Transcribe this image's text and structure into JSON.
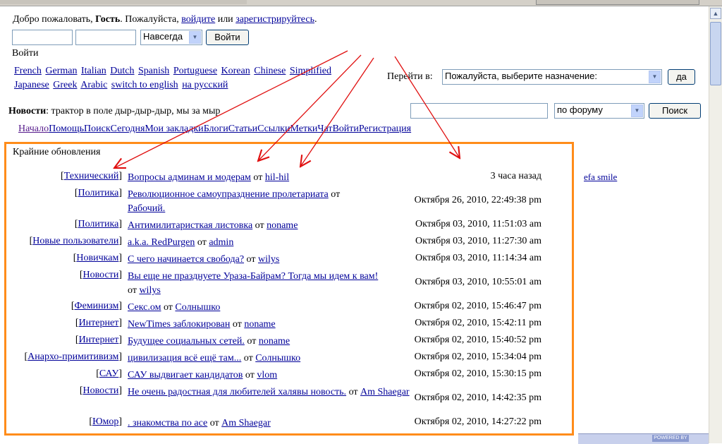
{
  "header": {
    "welcome_prefix": "Добро пожаловать, ",
    "guest": "Гость",
    "welcome_mid": ". Пожалуйста, ",
    "login_link": "войдите",
    "or": " или ",
    "register_link": "зарегистрируйтесь",
    "end": "."
  },
  "login_form": {
    "duration_selected": "Навсегда",
    "login_button": "Войти"
  },
  "login_label": "Войти",
  "languages": [
    "French",
    "German",
    "Italian",
    "Dutch",
    "Spanish",
    "Portuguese",
    "Korean",
    "Chinese",
    "Simplified",
    "Japanese",
    "Greek",
    "Arabic",
    "switch to english",
    "на русский"
  ],
  "jump": {
    "label": "Перейти в:",
    "selected": "Пожалуйста, выберите назначение:",
    "go_button": "да"
  },
  "news": {
    "label": "Новости",
    "text": ": трактор в поле дыр-дыр-дыр, мы за мыр"
  },
  "search": {
    "scope_selected": "по форуму",
    "search_button": "Поиск"
  },
  "nav": [
    "Начало",
    "Помощь",
    "Поиск",
    "Сегодня",
    "Мои закладки",
    "Блоги",
    "Статьи",
    "Ссылки",
    "Метки",
    "Чат",
    "Войти",
    "Регистрация"
  ],
  "recent": {
    "title": "Крайние обновления",
    "by": "от",
    "rows": [
      {
        "category": "Технический",
        "topic": "Вопросы админам и модерам",
        "author": "hil-hil",
        "time": "3 часа назад"
      },
      {
        "category": "Политика",
        "topic": "Революционное самоупразднение пролетариата",
        "author": "Рабочий.",
        "time": "Октября 26, 2010, 22:49:38 pm"
      },
      {
        "category": "Политика",
        "topic": "Антимилитаристкая листовка",
        "author": "noname",
        "time": "Октября 03, 2010, 11:51:03 am"
      },
      {
        "category": "Новые пользователи",
        "topic": "a.k.a. RedPurgen",
        "author": "admin",
        "time": "Октября 03, 2010, 11:27:30 am"
      },
      {
        "category": "Новичкам",
        "topic": "С чего начинается свобода?",
        "author": "wilys",
        "time": "Октября 03, 2010, 11:14:34 am"
      },
      {
        "category": "Новости",
        "topic": "Вы еще не празднуете Ураза-Байрам? Тогда мы идем к вам!",
        "author": "wilys",
        "time": "Октября 03, 2010, 10:55:01 am"
      },
      {
        "category": "Феминизм",
        "topic": "Секс.ом",
        "author": "Солнышко",
        "time": "Октября 02, 2010, 15:46:47 pm"
      },
      {
        "category": "Интернет",
        "topic": "NewTimes заблокирован",
        "author": "noname",
        "time": "Октября 02, 2010, 15:42:11 pm"
      },
      {
        "category": "Интернет",
        "topic": "Будущее социальных сетей.",
        "author": "noname",
        "time": "Октября 02, 2010, 15:40:52 pm"
      },
      {
        "category": "Анархо-примитивизм",
        "topic": "цивилизация всё ещё там...",
        "author": "Солнышко",
        "time": "Октября 02, 2010, 15:34:04 pm"
      },
      {
        "category": "САУ",
        "topic": "САУ выдвигает кандидатов",
        "author": "vlom",
        "time": "Октября 02, 2010, 15:30:15 pm"
      },
      {
        "category": "Новости",
        "topic": "Не очень радостная для любителей халявы новость.",
        "author": "Am Shaegar",
        "time": "Октября 02, 2010, 14:42:35 pm"
      },
      {
        "category": "Юмор",
        "topic": ".       знакомства по асе",
        "author": "Am Shaegar",
        "time": "Октября 02, 2010, 14:27:22 pm"
      }
    ]
  },
  "side_fragment": "efa smile",
  "ad_strip_text": "POWERED BY",
  "colors": {
    "link": "#000099",
    "highlight_box": "#ff8c1a",
    "arrow": "#e01010"
  }
}
